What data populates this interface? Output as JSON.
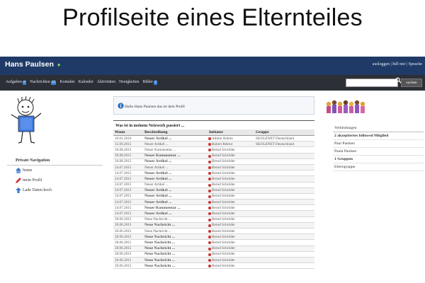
{
  "slide": {
    "title": "Profilseite eines Elternteiles"
  },
  "header": {
    "user_name": "Hans Paulsen",
    "links": "ausloggen | hilf mir | Sprache"
  },
  "nav": {
    "items": [
      {
        "label": "Aufgaben",
        "badge": "0"
      },
      {
        "label": "Nachrichten",
        "badge": "13"
      },
      {
        "label": "Kontakte",
        "badge": ""
      },
      {
        "label": "Kalender",
        "badge": ""
      },
      {
        "label": "Aktivitäten",
        "badge": ""
      },
      {
        "label": "Neuigkeiten",
        "badge": ""
      },
      {
        "label": "Bilder",
        "badge": "2"
      }
    ],
    "search": {
      "placeholder": "",
      "button_label": "suchen"
    }
  },
  "private_nav": {
    "title": "Private Navigation",
    "items": [
      {
        "label": "home",
        "icon": "home-icon"
      },
      {
        "label": "mein Profil",
        "icon": "pencil-icon"
      },
      {
        "label": "Lade Daten hoch",
        "icon": "upload-icon"
      }
    ]
  },
  "info": {
    "message": "Hallo Hans Paulsen das ist dein Profil"
  },
  "feed": {
    "title": "Was ist in meinem Netzwerk passiert ...",
    "columns": [
      "Wann",
      "Beschreibung",
      "Initiator",
      "Gruppe"
    ],
    "rows": [
      {
        "date": "10.01.2016",
        "desc": "Neuer Artikel ...",
        "strong": true,
        "initiator": "Admin Admin",
        "group": "SKOLENET Deutschland"
      },
      {
        "date": "15.09.2015",
        "desc": "Neuer Artikel ...",
        "strong": false,
        "initiator": "Robert Rektor",
        "group": "SKOLENET Deutschland"
      },
      {
        "date": "26.08.2015",
        "desc": "Neuer Kommentar ...",
        "strong": false,
        "initiator": "Bernd Schröder",
        "group": ""
      },
      {
        "date": "26.08.2015",
        "desc": "Neuer Kommentar ...",
        "strong": true,
        "initiator": "Bernd Schröder",
        "group": ""
      },
      {
        "date": "26.08.2015",
        "desc": "Neuer Artikel ...",
        "strong": true,
        "initiator": "Bernd Schröder",
        "group": ""
      },
      {
        "date": "24.07.2015",
        "desc": "Neuer Artikel ...",
        "strong": false,
        "initiator": "Bernd Schröder",
        "group": ""
      },
      {
        "date": "24.07.2015",
        "desc": "Neuer Artikel ...",
        "strong": true,
        "initiator": "Bernd Schröder",
        "group": ""
      },
      {
        "date": "24.07.2015",
        "desc": "Neuer Artikel ...",
        "strong": true,
        "initiator": "Bernd Schröder",
        "group": ""
      },
      {
        "date": "24.07.2015",
        "desc": "Neuer Artikel ...",
        "strong": false,
        "initiator": "Bernd Schröder",
        "group": ""
      },
      {
        "date": "24.07.2015",
        "desc": "Neuer Artikel ...",
        "strong": true,
        "initiator": "Bernd Schröder",
        "group": ""
      },
      {
        "date": "24.07.2015",
        "desc": "Neuer Artikel ...",
        "strong": true,
        "initiator": "Bernd Schröder",
        "group": ""
      },
      {
        "date": "24.07.2015",
        "desc": "Neuer Artikel ...",
        "strong": true,
        "initiator": "Bernd Schröder",
        "group": ""
      },
      {
        "date": "24.07.2015",
        "desc": "Neuer Kommentar ...",
        "strong": true,
        "initiator": "Bernd Schröder",
        "group": ""
      },
      {
        "date": "24.07.2015",
        "desc": "Neuer Artikel ...",
        "strong": true,
        "initiator": "Bernd Schröder",
        "group": ""
      },
      {
        "date": "20.06.2015",
        "desc": "Neue Nachricht ...",
        "strong": false,
        "initiator": "Bernd Schröder",
        "group": ""
      },
      {
        "date": "20.06.2015",
        "desc": "Neue Nachricht ...",
        "strong": true,
        "initiator": "Bernd Schröder",
        "group": ""
      },
      {
        "date": "20.06.2015",
        "desc": "Neue Nachricht ...",
        "strong": false,
        "initiator": "Bernd Schröder",
        "group": ""
      },
      {
        "date": "20.06.2015",
        "desc": "Neue Nachricht ...",
        "strong": true,
        "initiator": "Bernd Schröder",
        "group": ""
      },
      {
        "date": "20.06.2015",
        "desc": "Neue Nachricht ...",
        "strong": true,
        "initiator": "Bernd Schröder",
        "group": ""
      },
      {
        "date": "20.06.2015",
        "desc": "Neue Nachricht ...",
        "strong": true,
        "initiator": "Bernd Schröder",
        "group": ""
      },
      {
        "date": "20.06.2015",
        "desc": "Neue Nachricht ...",
        "strong": true,
        "initiator": "Bernd Schröder",
        "group": ""
      },
      {
        "date": "20.06.2015",
        "desc": "Neue Nachricht ...",
        "strong": true,
        "initiator": "Bernd Schröder",
        "group": ""
      },
      {
        "date": "20.06.2015",
        "desc": "Neue Nachricht ...",
        "strong": true,
        "initiator": "Bernd Schröder",
        "group": ""
      },
      {
        "date": "20.06.2015",
        "desc": "Neue Nachricht ...",
        "strong": true,
        "initiator": "Bernd Schröder",
        "group": ""
      }
    ]
  },
  "connections": {
    "title": "Verbindungen",
    "rows": [
      {
        "label": "2 akzeptiertes followed Mitglied",
        "bold": true
      },
      {
        "label": "Paul Paulsen",
        "bold": false
      },
      {
        "label": "Paula Paulsen",
        "bold": false
      },
      {
        "label": "1 Gruppen",
        "bold": true
      },
      {
        "label": "Elterngruppe",
        "bold": false
      }
    ]
  },
  "colors": {
    "topbar": "#1f3a66",
    "navbar": "#2c2f36",
    "link": "#3467b8",
    "badge": "#3f86d8"
  }
}
